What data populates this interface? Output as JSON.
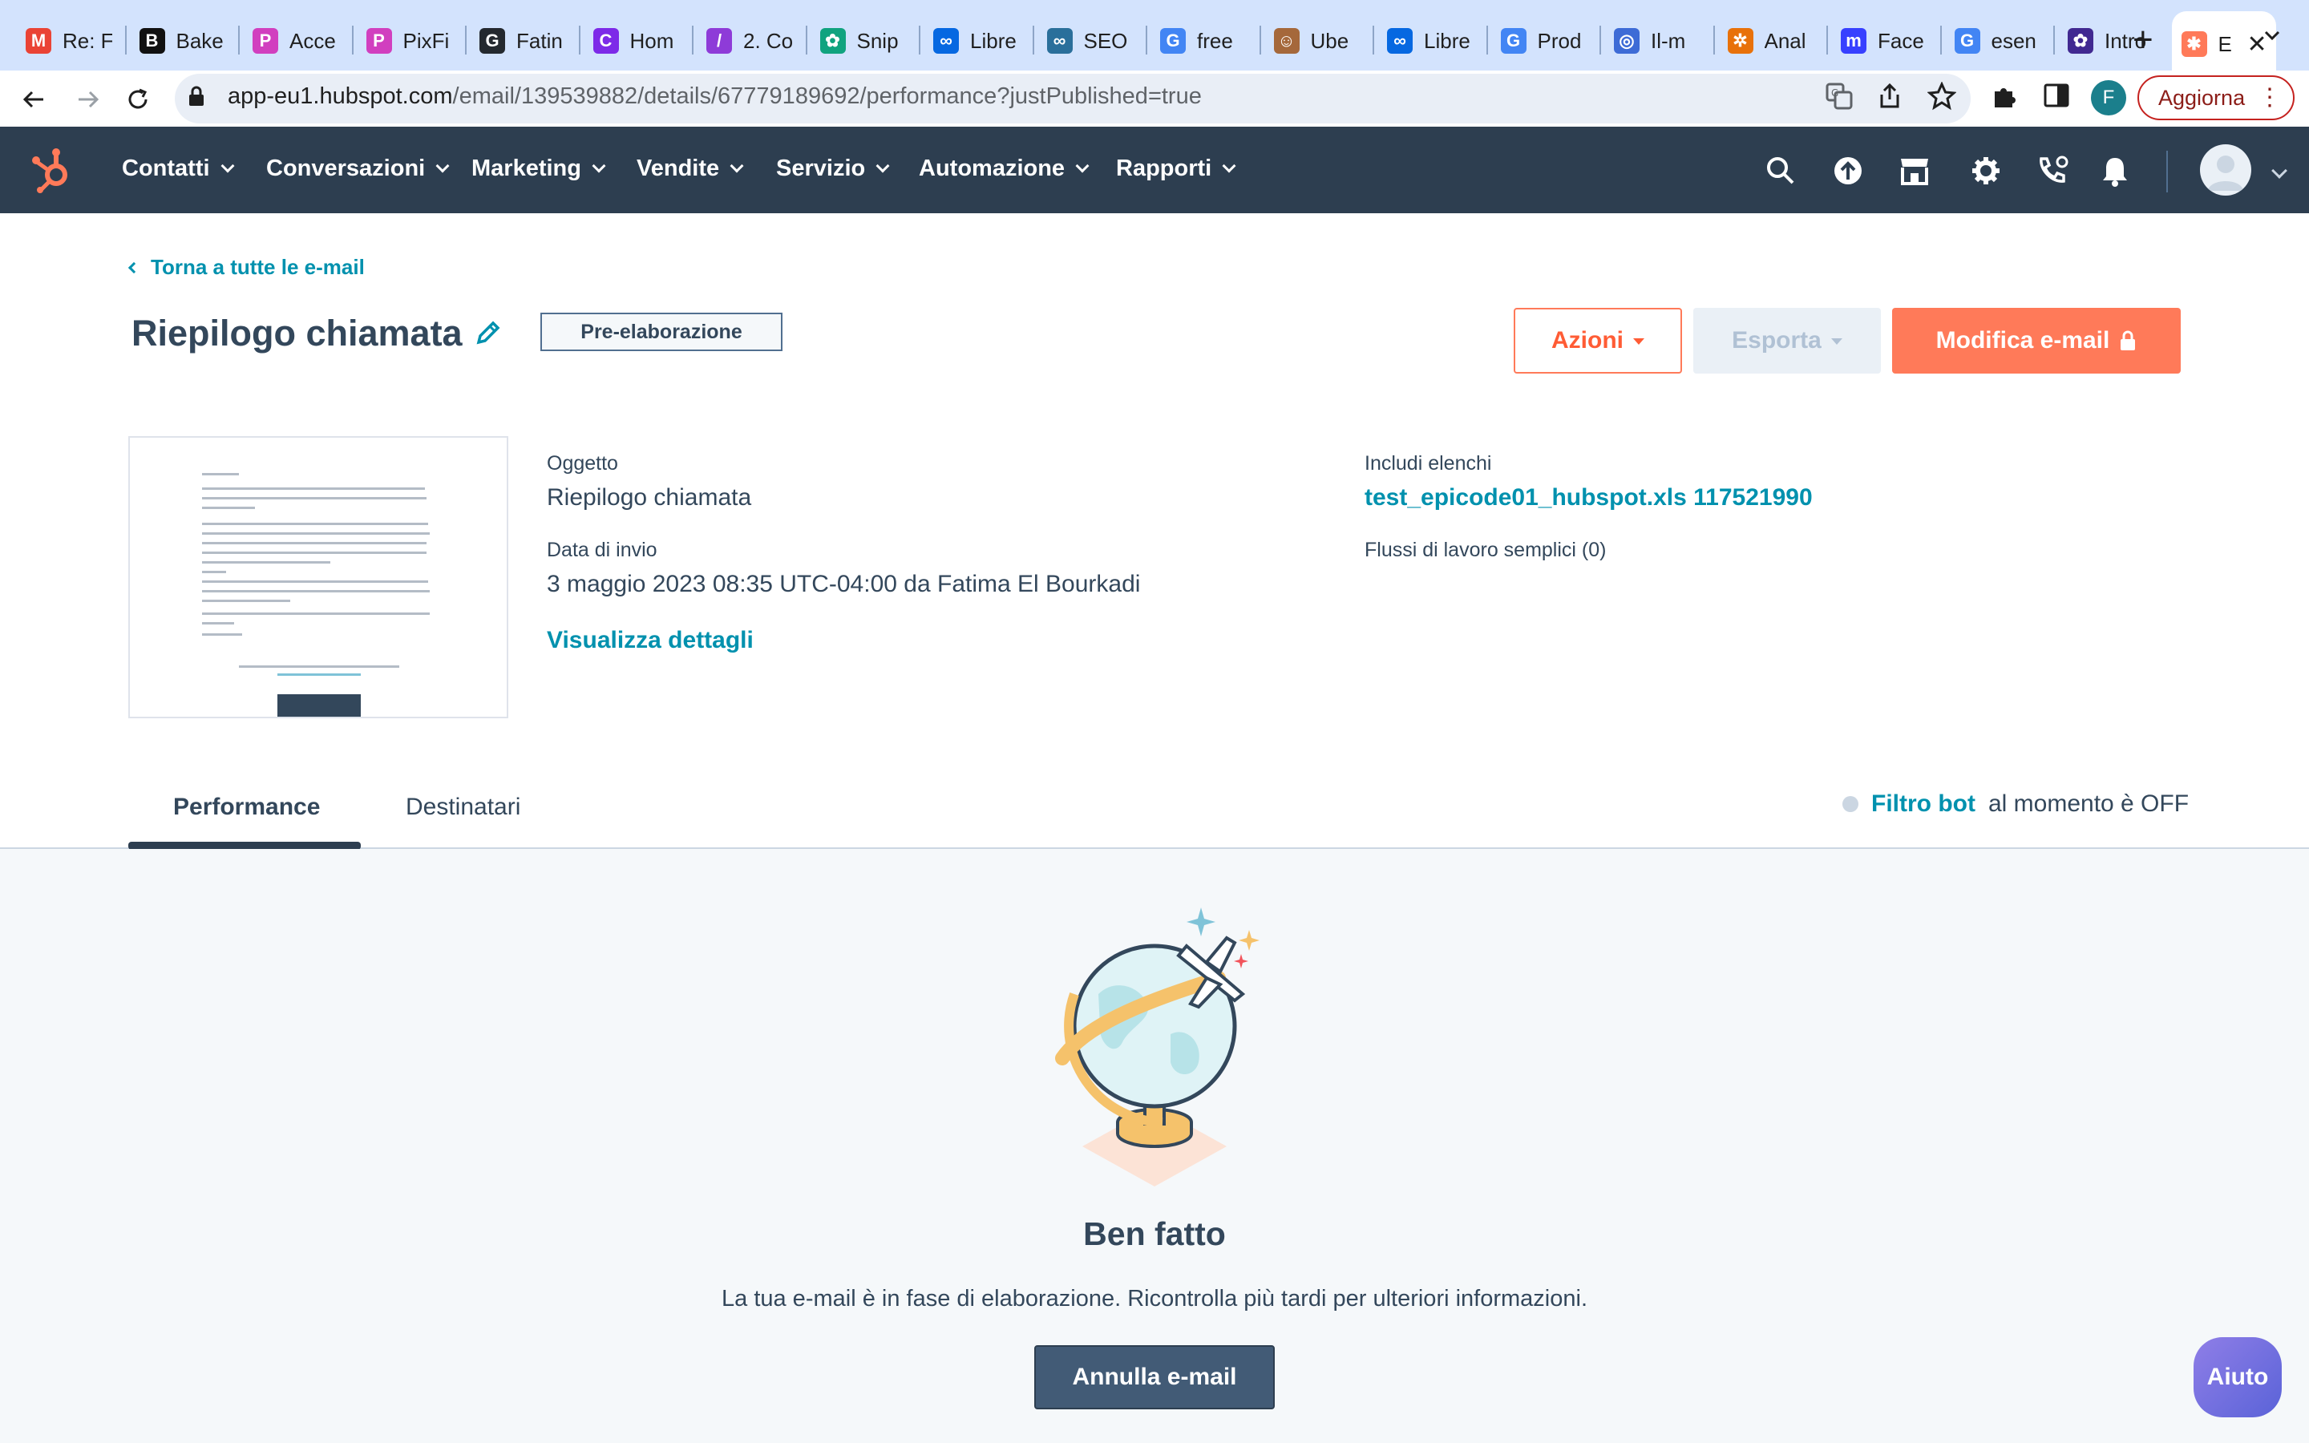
{
  "browser": {
    "tabs": [
      {
        "title": "Re: F",
        "icon": "gmail-icon",
        "color": "#ea4335",
        "glyph": "M"
      },
      {
        "title": "Bake",
        "icon": "b-icon",
        "color": "#111111",
        "glyph": "B"
      },
      {
        "title": "Acce",
        "icon": "pixfind-icon",
        "color": "#d13fbf",
        "glyph": "P"
      },
      {
        "title": "PixFi",
        "icon": "pixfind-icon",
        "color": "#d13fbf",
        "glyph": "P"
      },
      {
        "title": "Fatin",
        "icon": "github-icon",
        "color": "#24292f",
        "glyph": "G"
      },
      {
        "title": "Hom",
        "icon": "canva-icon",
        "color": "#7d2ae8",
        "glyph": "C"
      },
      {
        "title": "2. Co",
        "icon": "slides-icon",
        "color": "#8e3bd8",
        "glyph": "/"
      },
      {
        "title": "Snip",
        "icon": "chatgpt-icon",
        "color": "#10a37f",
        "glyph": "✿"
      },
      {
        "title": "Libre",
        "icon": "meta-icon",
        "color": "#0668e1",
        "glyph": "∞"
      },
      {
        "title": "SEO",
        "icon": "seo-icon",
        "color": "#2a6f9b",
        "glyph": "∞"
      },
      {
        "title": "free",
        "icon": "google-icon",
        "color": "#4285f4",
        "glyph": "G"
      },
      {
        "title": "Ube",
        "icon": "avatar-icon",
        "color": "#a5683b",
        "glyph": "☺"
      },
      {
        "title": "Libre",
        "icon": "meta-icon",
        "color": "#0668e1",
        "glyph": "∞"
      },
      {
        "title": "Prod",
        "icon": "google-icon",
        "color": "#4285f4",
        "glyph": "G"
      },
      {
        "title": "Il-m",
        "icon": "spiral-icon",
        "color": "#3d6bd6",
        "glyph": "◎"
      },
      {
        "title": "Anal",
        "icon": "looker-icon",
        "color": "#e8710a",
        "glyph": "✲"
      },
      {
        "title": "Face",
        "icon": "miro-icon",
        "color": "#3740ff",
        "glyph": "m"
      },
      {
        "title": "esen",
        "icon": "google-icon",
        "color": "#4285f4",
        "glyph": "G"
      },
      {
        "title": "Intro",
        "icon": "openai-icon",
        "color": "#412991",
        "glyph": "✿"
      },
      {
        "title": "E",
        "icon": "hubspot-icon",
        "color": "#ff7a59",
        "glyph": "✱",
        "active": true
      }
    ],
    "url_host": "app-eu1.hubspot.com",
    "url_path": "/email/139539882/details/67779189692/performance?justPublished=true",
    "profile_initial": "F",
    "update_label": "Aggiorna"
  },
  "nav": {
    "items": [
      "Contatti",
      "Conversazioni",
      "Marketing",
      "Vendite",
      "Servizio",
      "Automazione",
      "Rapporti"
    ]
  },
  "page": {
    "back_link": "Torna a tutte le e-mail",
    "title": "Riepilogo chiamata",
    "status": "Pre-elaborazione",
    "actions_label": "Azioni",
    "export_label": "Esporta",
    "edit_label": "Modifica e-mail"
  },
  "summary": {
    "subject_label": "Oggetto",
    "subject_value": "Riepilogo chiamata",
    "send_date_label": "Data di invio",
    "send_date_value": "3 maggio 2023 08:35 UTC-04:00 da Fatima El Bourkadi",
    "details_link": "Visualizza dettagli",
    "lists_label": "Includi elenchi",
    "lists_value": "test_epicode01_hubspot.xls 117521990",
    "workflows_label": "Flussi di lavoro semplici (0)"
  },
  "tabs": {
    "performance": "Performance",
    "recipients": "Destinatari"
  },
  "bot_filter": {
    "link": "Filtro bot",
    "text": "al momento è OFF"
  },
  "empty_state": {
    "heading": "Ben fatto",
    "text": "La tua e-mail è in fase di elaborazione. Ricontrolla più tardi per ulteriori informazioni.",
    "cancel_label": "Annulla e-mail"
  },
  "help_label": "Aiuto",
  "colors": {
    "hubspot_orange": "#ff7a59",
    "nav_bg": "#2d3e50",
    "link": "#0091ae",
    "text": "#33475b"
  }
}
